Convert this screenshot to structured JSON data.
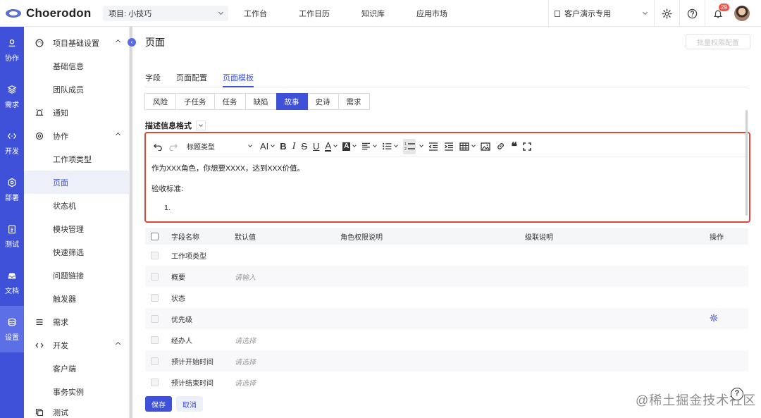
{
  "app": {
    "logo_text": "Choerodon"
  },
  "header": {
    "project_select": "项目: 小技巧",
    "nav": [
      "工作台",
      "工作日历",
      "知识库",
      "应用市场"
    ],
    "org_select": "客户演示专用",
    "notification_count": "29"
  },
  "rail": [
    {
      "label": "协作",
      "icon": "collab-icon"
    },
    {
      "label": "需求",
      "icon": "layers-icon"
    },
    {
      "label": "开发",
      "icon": "code-icon"
    },
    {
      "label": "部署",
      "icon": "deploy-icon"
    },
    {
      "label": "测试",
      "icon": "clipboard-icon"
    },
    {
      "label": "文档",
      "icon": "inbox-icon"
    },
    {
      "label": "设置",
      "icon": "settings-icon"
    }
  ],
  "sidemenu": {
    "basic_settings": "项目基础设置",
    "basic_info": "基础信息",
    "team_members": "团队成员",
    "notify": "通知",
    "collab": "协作",
    "issue_types": "工作项类型",
    "page": "页面",
    "state_machine": "状态机",
    "modules": "模块管理",
    "quick_filter": "快速筛选",
    "issue_link": "问题链接",
    "trigger": "触发器",
    "requirement": "需求",
    "dev": "开发",
    "client": "客户端",
    "transaction": "事务实例",
    "test": "测试"
  },
  "main": {
    "title": "页面",
    "batch_button": "批量权限配置",
    "tabs": [
      "字段",
      "页面配置",
      "页面模板"
    ],
    "issue_types": [
      "风险",
      "子任务",
      "任务",
      "缺陷",
      "故事",
      "史诗",
      "需求"
    ],
    "desc_label": "描述信息格式",
    "editor": {
      "heading_select": "标题类型",
      "line1": "作为XXX角色，你想要XXXX，达到XXX价值。",
      "line2": "验收标准:",
      "list_item": "1."
    },
    "table": {
      "headers": [
        "字段名称",
        "默认值",
        "角色权限说明",
        "级联说明",
        "操作"
      ],
      "rows": [
        {
          "name": "工作项类型",
          "default": ""
        },
        {
          "name": "概要",
          "default": "请输入"
        },
        {
          "name": "状态",
          "default": ""
        },
        {
          "name": "优先级",
          "default": ""
        },
        {
          "name": "经办人",
          "default": "请选择"
        },
        {
          "name": "预计开始时间",
          "default": "请选择"
        },
        {
          "name": "预计结束时间",
          "default": "请选择"
        }
      ]
    },
    "save": "保存",
    "cancel": "取消"
  },
  "watermark": "@稀土掘金技术社区",
  "colors": {
    "primary": "#3f51d8",
    "highlight": "#e1463a",
    "badge": "#f5554a"
  }
}
